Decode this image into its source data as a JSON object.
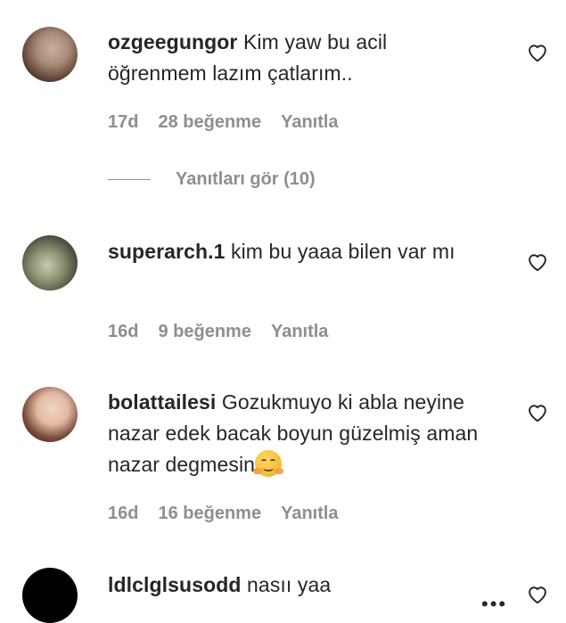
{
  "comments": [
    {
      "username": "ozgeegungor",
      "text": "Kim yaw bu acil öğrenmem lazım çatlarım..",
      "age": "17d",
      "likes": "28 beğenme",
      "reply_label": "Yanıtla",
      "view_replies": "Yanıtları gör (10)",
      "avatar_colors": [
        "#b9a28f",
        "#5a4033"
      ]
    },
    {
      "username": "superarch.1",
      "text": "kim bu yaaa bilen var mı",
      "age": "16d",
      "likes": "9 beğenme",
      "reply_label": "Yanıtla",
      "avatar_colors": [
        "#8f9573",
        "#3d3b33"
      ]
    },
    {
      "username": "bolattailesi",
      "text": "Gozukmuyo ki abla neyine nazar edek bacak boyun güzelmiş aman nazar degmesin",
      "emoji": "smiling-hug-emoji",
      "age": "16d",
      "likes": "16 beğenme",
      "reply_label": "Yanıtla",
      "avatar_colors": [
        "#e8c7b4",
        "#3b2620"
      ]
    },
    {
      "username": "ldlclglsusodd",
      "text": "nasıı yaa",
      "avatar_colors": [
        "#000000",
        "#000000"
      ]
    }
  ],
  "more_label": "•••",
  "icons": {
    "like": "heart-outline-icon",
    "more": "more-dots-icon"
  }
}
